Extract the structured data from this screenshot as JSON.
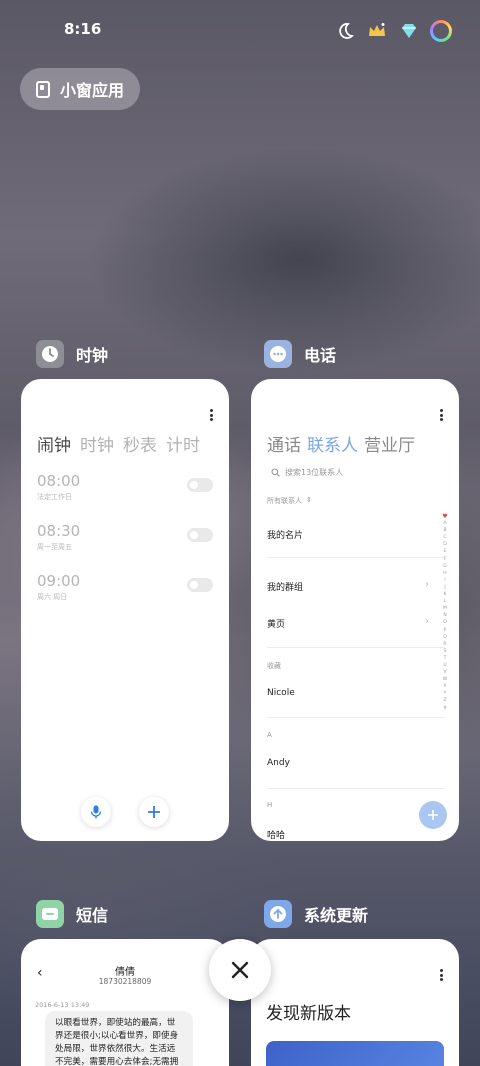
{
  "status_bar": {
    "time": "8:16",
    "icons": [
      "moon-icon",
      "crown-icon",
      "diamond-icon",
      "ring-icon"
    ]
  },
  "floating_window_button": {
    "label": "小窗应用"
  },
  "apps": {
    "clock": {
      "title": "时钟",
      "icon_color": "#8e8e96",
      "tabs": [
        "闹钟",
        "时钟",
        "秒表",
        "计时"
      ],
      "alarms": [
        {
          "time": "08:00",
          "repeat": "法定工作日"
        },
        {
          "time": "08:30",
          "repeat": "周一至周五"
        },
        {
          "time": "09:00",
          "repeat": "周六 周日"
        }
      ],
      "mic_icon": "microphone-icon",
      "add_icon": "plus-icon"
    },
    "phone": {
      "title": "电话",
      "icon_color": "#9bb3e0",
      "tabs": [
        "通话",
        "联系人",
        "营业厅"
      ],
      "search_placeholder": "搜索13位联系人",
      "filter_label": "所有联系人",
      "rows": {
        "my_card": "我的名片",
        "my_groups": "我的群组",
        "yellow_pages": "黄页"
      },
      "section_favorites": "收藏",
      "contact_nicole": "Nicole",
      "section_a": "A",
      "contact_andy": "Andy",
      "section_h": "H",
      "contact_haha": "哈哈",
      "index_letters": [
        "♥",
        "A",
        "B",
        "C",
        "D",
        "E",
        "F",
        "G",
        "H",
        "I",
        "J",
        "K",
        "L",
        "M",
        "N",
        "O",
        "P",
        "Q",
        "R",
        "S",
        "T",
        "U",
        "V",
        "W",
        "X",
        "Y",
        "Z",
        "#"
      ]
    },
    "sms": {
      "title": "短信",
      "icon_color": "#8fd3a6",
      "contact_name": "倩倩",
      "contact_number": "18730218809",
      "timestamp": "2016-6-13 13:49",
      "message": "以眼看世界，即使站的最高，世界还是很小;以心看世界，即使身处局限，世界依然很大。生活远不完美，需要用心去体会;无需拥有太"
    },
    "update": {
      "title": "系统更新",
      "icon_color": "#7fa8e8",
      "headline": "发现新版本"
    }
  },
  "colors": {
    "accent_blue": "#2f7de1",
    "phone_active_tab": "#7aa6e8",
    "alarm_heart": "#e5484d"
  }
}
